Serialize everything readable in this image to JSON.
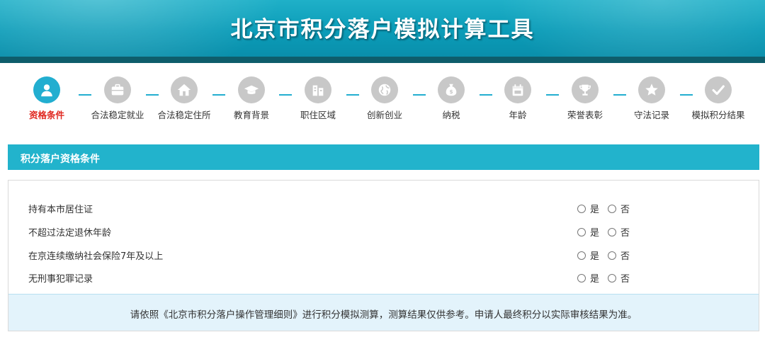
{
  "header": {
    "title": "北京市积分落户模拟计算工具",
    "colors": {
      "banner": "#0b9cb8",
      "strip": "#0e5d6b"
    }
  },
  "steps": [
    {
      "label": "资格条件",
      "icon": "person-icon",
      "active": true
    },
    {
      "label": "合法稳定就业",
      "icon": "briefcase-icon",
      "active": false
    },
    {
      "label": "合法稳定住所",
      "icon": "house-icon",
      "active": false
    },
    {
      "label": "教育背景",
      "icon": "graduation-cap-icon",
      "active": false
    },
    {
      "label": "职住区域",
      "icon": "buildings-icon",
      "active": false
    },
    {
      "label": "创新创业",
      "icon": "globe-icon",
      "active": false
    },
    {
      "label": "纳税",
      "icon": "money-bag-icon",
      "active": false
    },
    {
      "label": "年龄",
      "icon": "calendar-icon",
      "active": false
    },
    {
      "label": "荣誉表彰",
      "icon": "trophy-icon",
      "active": false
    },
    {
      "label": "守法记录",
      "icon": "star-icon",
      "active": false
    },
    {
      "label": "模拟积分结果",
      "icon": "check-icon",
      "active": false
    }
  ],
  "section": {
    "title": "积分落户资格条件"
  },
  "questions": [
    {
      "text": "持有本市居住证",
      "yes": "是",
      "no": "否"
    },
    {
      "text": "不超过法定退休年龄",
      "yes": "是",
      "no": "否"
    },
    {
      "text": "在京连续缴纳社会保险7年及以上",
      "yes": "是",
      "no": "否"
    },
    {
      "text": "无刑事犯罪记录",
      "yes": "是",
      "no": "否"
    }
  ],
  "notice": {
    "text": "请依照《北京市积分落户操作管理细则》进行积分模拟测算，测算结果仅供参考。申请人最终积分以实际审核结果为准。"
  },
  "colors": {
    "accent": "#22aed0",
    "active_label": "#e0271f",
    "inactive": "#c8c8c8"
  }
}
